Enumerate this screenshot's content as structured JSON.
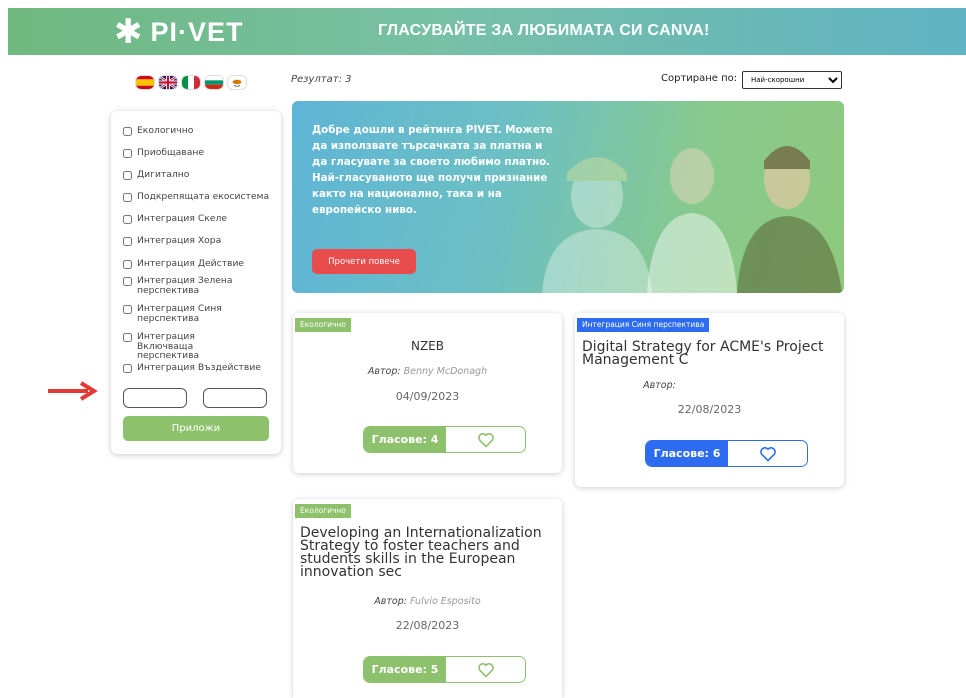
{
  "header": {
    "logo_star": "✱",
    "logo_text": "PI·VET",
    "title": "ГЛАСУВАЙТЕ ЗА ЛЮБИМАТА СИ CANVA!"
  },
  "languages": [
    "spanish-flag-icon",
    "uk-flag-icon",
    "italian-flag-icon",
    "bulgarian-flag-icon",
    "cyprus-flag-icon"
  ],
  "results": {
    "label": "Резултат: 3"
  },
  "sort": {
    "label": "Сортиране по:",
    "selected": "Най-скорошни"
  },
  "filters": [
    "Екологично",
    "Приобщаване",
    "Дигитално",
    "Подкрепящата екосистема",
    "Интеграция Скеле",
    "Интеграция Хора",
    "Интеграция Действие",
    "Интеграция Зелена перспектива",
    "Интеграция Синя перспектива",
    "Интеграция Включваща перспектива",
    "Интеграция Въздействие"
  ],
  "apply_button": "Приложи",
  "banner": {
    "text": "Добре дошли в рейтинга PIVET. Можете да използвате търсачката за платна и да гласувате за своето любимо платно. Най-гласуваното ще получи признание както на национално, така и на европейско ниво.",
    "button": "Прочети повече"
  },
  "cards": [
    {
      "tag": "Екологично",
      "title": "NZEB",
      "author_label": "Автор:",
      "author": "Benny McDonagh",
      "date": "04/09/2023",
      "votes": "Гласове: 4"
    },
    {
      "tag": "Интеграция Синя перспектива",
      "title": "Digital Strategy for ACME's Project Management C",
      "author_label": "Автор:",
      "author": "",
      "date": "22/08/2023",
      "votes": "Гласове: 6"
    },
    {
      "tag": "Екологично",
      "title": "Developing an Internationalization Strategy to foster teachers and students skills in the European innovation sec",
      "author_label": "Автор:",
      "author": "Fulvio Esposito",
      "date": "22/08/2023",
      "votes": "Гласове: 5"
    }
  ],
  "colors": {
    "green": "#8dc16b",
    "blue": "#2d6cf0",
    "red": "#e84c4c"
  }
}
